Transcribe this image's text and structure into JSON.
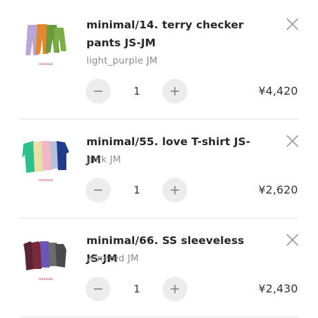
{
  "cart": {
    "items": [
      {
        "title": "minimal/14. terry checker pants JS-JM",
        "variant": "light_purple JM",
        "quantity": "1",
        "price": "¥4,420",
        "thumbnail": "product-photo-pants",
        "brand_mark": "minimal"
      },
      {
        "title": "minimal/55. love T-shirt JS-JM",
        "variant": "pink JM",
        "quantity": "1",
        "price": "¥2,620",
        "thumbnail": "product-photo-tshirts",
        "brand_mark": "minimal"
      },
      {
        "title": "minimal/66. SS sleeveless JS-JM",
        "variant": "winered JM",
        "quantity": "1",
        "price": "¥2,430",
        "thumbnail": "product-photo-sleeveless",
        "brand_mark": "minimal"
      }
    ],
    "icons": {
      "remove": "close-icon",
      "decrease": "minus-icon",
      "increase": "plus-icon"
    },
    "colors": {
      "text": "#262626",
      "muted": "#8a8a8a",
      "button_bg": "#ececec",
      "icon": "#9a9a9a",
      "brand_mark": "#c0262d"
    }
  }
}
